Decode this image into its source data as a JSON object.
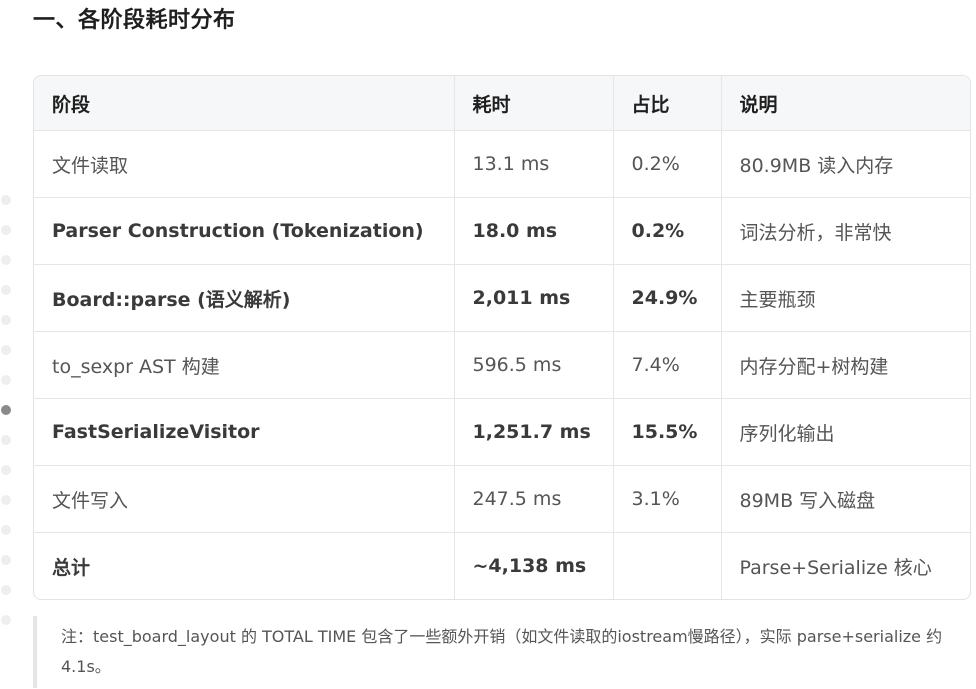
{
  "heading": "一、各阶段耗时分布",
  "table": {
    "headers": [
      "阶段",
      "耗时",
      "占比",
      "说明"
    ],
    "rows": [
      {
        "bold": false,
        "cells": [
          "文件读取",
          "13.1 ms",
          "0.2%",
          "80.9MB 读入内存"
        ]
      },
      {
        "bold": true,
        "cells": [
          "Parser Construction (Tokenization)",
          "18.0 ms",
          "0.2%",
          "词法分析，非常快"
        ]
      },
      {
        "bold": true,
        "cells": [
          "Board::parse (语义解析)",
          "2,011 ms",
          "24.9%",
          "主要瓶颈"
        ]
      },
      {
        "bold": false,
        "cells": [
          "to_sexpr AST 构建",
          "596.5 ms",
          "7.4%",
          "内存分配+树构建"
        ]
      },
      {
        "bold": true,
        "cells": [
          "FastSerializeVisitor",
          "1,251.7 ms",
          "15.5%",
          "序列化输出"
        ]
      },
      {
        "bold": false,
        "cells": [
          "文件写入",
          "247.5 ms",
          "3.1%",
          "89MB 写入磁盘"
        ]
      },
      {
        "bold": true,
        "cells": [
          "总计",
          "~4,138 ms",
          "",
          "Parse+Serialize 核心"
        ]
      }
    ]
  },
  "note": "注：test_board_layout 的 TOTAL TIME 包含了一些额外开销（如文件读取的iostream慢路径），实际 parse+serialize 约 4.1s。"
}
